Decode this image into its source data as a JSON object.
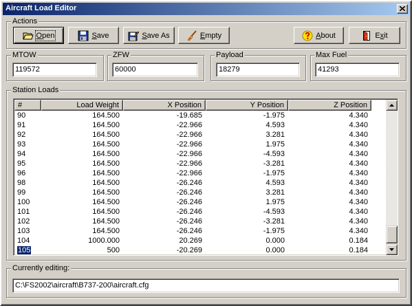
{
  "window": {
    "title": "Aircraft Load Editor",
    "close_icon": "close-icon"
  },
  "actions": {
    "legend": "Actions",
    "buttons": [
      {
        "pre": "",
        "accel": "O",
        "post": "pen",
        "icon": "open-folder-icon"
      },
      {
        "pre": "",
        "accel": "S",
        "post": "ave",
        "icon": "floppy-disk-icon"
      },
      {
        "pre": "",
        "accel": "S",
        "post": "ave As",
        "icon": "save-as-icon"
      },
      {
        "pre": "",
        "accel": "E",
        "post": "mpty",
        "icon": "broom-icon"
      },
      {
        "pre": "",
        "accel": "A",
        "post": "bout",
        "icon": "help-icon"
      },
      {
        "pre": "E",
        "accel": "x",
        "post": "it",
        "icon": "exit-door-icon"
      }
    ]
  },
  "fields": {
    "mtow": {
      "label": "MTOW",
      "value": "119572"
    },
    "zfw": {
      "label": "ZFW",
      "value": "60000"
    },
    "payload": {
      "label": "Payload",
      "value": "18279"
    },
    "max_fuel": {
      "label": "Max Fuel",
      "value": "41293"
    }
  },
  "station_loads": {
    "legend": "Station Loads",
    "columns": [
      "#",
      "Load Weight",
      "X Position",
      "Y Position",
      "Z Position"
    ],
    "rows": [
      {
        "n": "90",
        "w": "164.500",
        "x": "-19.685",
        "y": "-1.975",
        "z": "4.340"
      },
      {
        "n": "91",
        "w": "164.500",
        "x": "-22.966",
        "y": "4.593",
        "z": "4.340"
      },
      {
        "n": "92",
        "w": "164.500",
        "x": "-22.966",
        "y": "3.281",
        "z": "4.340"
      },
      {
        "n": "93",
        "w": "164.500",
        "x": "-22.966",
        "y": "1.975",
        "z": "4.340"
      },
      {
        "n": "94",
        "w": "164.500",
        "x": "-22.966",
        "y": "-4.593",
        "z": "4.340"
      },
      {
        "n": "95",
        "w": "164.500",
        "x": "-22.966",
        "y": "-3.281",
        "z": "4.340"
      },
      {
        "n": "96",
        "w": "164.500",
        "x": "-22.966",
        "y": "-1.975",
        "z": "4.340"
      },
      {
        "n": "98",
        "w": "164.500",
        "x": "-26.246",
        "y": "4.593",
        "z": "4.340"
      },
      {
        "n": "99",
        "w": "164.500",
        "x": "-26.246",
        "y": "3.281",
        "z": "4.340"
      },
      {
        "n": "100",
        "w": "164.500",
        "x": "-26.246",
        "y": "1.975",
        "z": "4.340"
      },
      {
        "n": "101",
        "w": "164.500",
        "x": "-26.246",
        "y": "-4.593",
        "z": "4.340"
      },
      {
        "n": "102",
        "w": "164.500",
        "x": "-26.246",
        "y": "-3.281",
        "z": "4.340"
      },
      {
        "n": "103",
        "w": "164.500",
        "x": "-26.246",
        "y": "-1.975",
        "z": "4.340"
      },
      {
        "n": "104",
        "w": "1000.000",
        "x": "20.269",
        "y": "0.000",
        "z": "0.184"
      },
      {
        "n": "105",
        "w": "500",
        "x": "-20.269",
        "y": "0.000",
        "z": "0.184",
        "editing": true
      }
    ]
  },
  "current": {
    "legend": "Currently editing:",
    "path": "C:\\FS2002\\aircraft\\B737-200\\aircraft.cfg"
  },
  "colors": {
    "titlebar_start": "#0a246a",
    "titlebar_end": "#a6caf0",
    "face": "#d4d0c8",
    "selection": "#0a246a"
  }
}
